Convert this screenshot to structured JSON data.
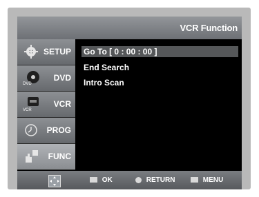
{
  "header": {
    "title": "VCR Function"
  },
  "sidebar": {
    "items": [
      {
        "label": "SETUP",
        "icon": "gear-icon"
      },
      {
        "label": "DVD",
        "icon": "dvd-disc-icon"
      },
      {
        "label": "VCR",
        "icon": "vcr-tape-icon"
      },
      {
        "label": "PROG",
        "icon": "clock-icon"
      },
      {
        "label": "FUNC",
        "icon": "hand-pointer-icon"
      }
    ]
  },
  "menu": {
    "items": [
      {
        "label": "Go To [ 0 : 00 : 00 ]"
      },
      {
        "label": "End Search"
      },
      {
        "label": "Intro Scan"
      }
    ]
  },
  "footer": {
    "ok_label": "OK",
    "return_label": "RETURN",
    "menu_label": "MENU"
  }
}
